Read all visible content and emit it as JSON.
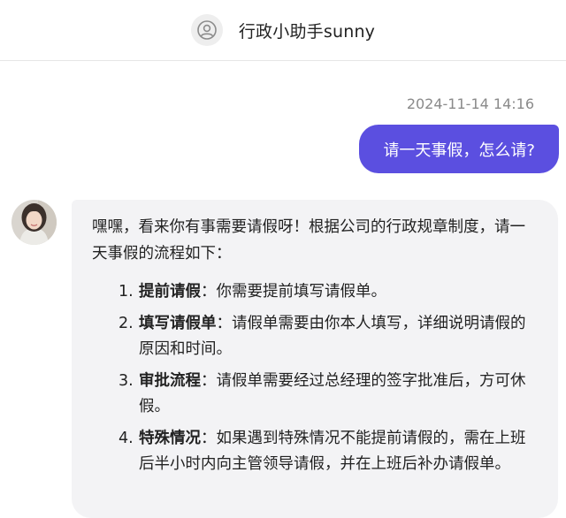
{
  "header": {
    "title": "行政小助手sunny",
    "avatar_icon": "user-circle-icon"
  },
  "conversation": {
    "timestamp": "2024-11-14 14:16",
    "user_message": "请一天事假，怎么请?",
    "bot_reply": {
      "intro": "嘿嘿，看来你有事需要请假呀！根据公司的行政规章制度，请一天事假的流程如下：",
      "steps": [
        {
          "num": "1.",
          "title": "提前请假",
          "text": "：你需要提前填写请假单。"
        },
        {
          "num": "2.",
          "title": "填写请假单",
          "text": "：请假单需要由你本人填写，详细说明请假的原因和时间。"
        },
        {
          "num": "3.",
          "title": "审批流程",
          "text": "：请假单需要经过总经理的签字批准后，方可休假。"
        },
        {
          "num": "4.",
          "title": "特殊情况",
          "text": "：如果遇到特殊情况不能提前请假的，需在上班后半小时内向主管领导请假，并在上班后补办请假单。"
        }
      ]
    }
  },
  "colors": {
    "user_bubble": "#5b4fe0",
    "bot_bubble": "#f3f3f5",
    "timestamp": "#8a8a8a"
  }
}
